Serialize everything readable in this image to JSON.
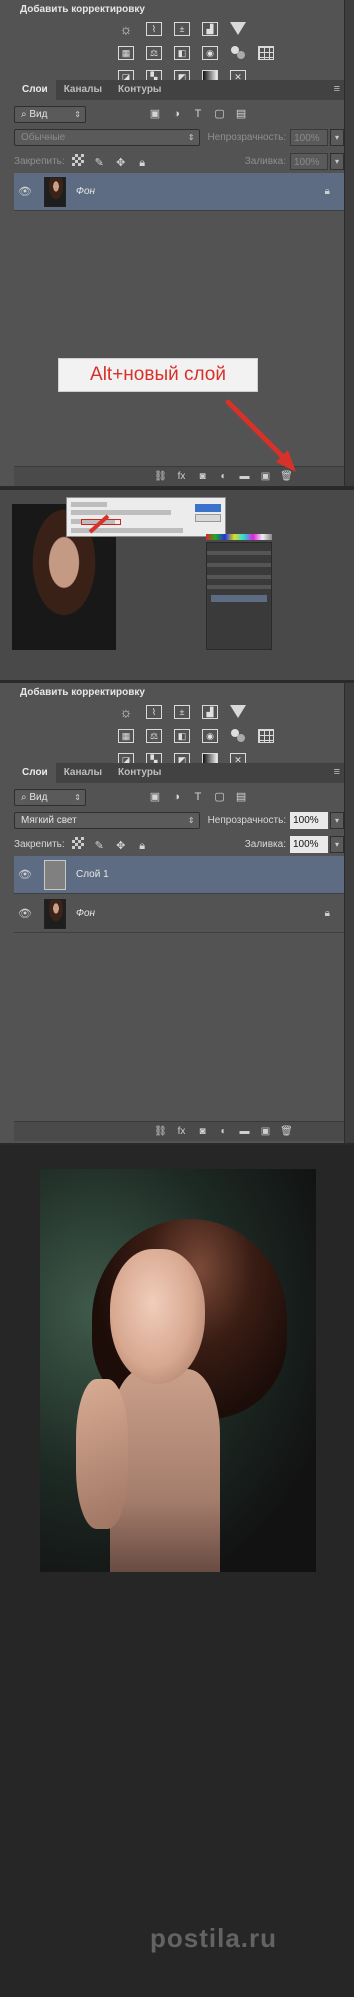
{
  "panel_top": {
    "adjustments_title": "Добавить корректировку",
    "tabs": [
      "Слои",
      "Каналы",
      "Контуры"
    ],
    "filter_label": "Вид",
    "blend_mode": "Обычные",
    "opacity_label": "Непрозрачность:",
    "opacity_value": "100%",
    "lock_label": "Закрепить:",
    "fill_label": "Заливка:",
    "fill_value": "100%",
    "layers": [
      {
        "name": "Фон",
        "locked": true,
        "selected": true
      }
    ]
  },
  "annotation": {
    "tooltip_text": "Alt+новый слой",
    "accent_color": "#d7322a"
  },
  "panel_bottom": {
    "adjustments_title": "Добавить корректировку",
    "tabs": [
      "Слои",
      "Каналы",
      "Контуры"
    ],
    "filter_label": "Вид",
    "blend_mode": "Мягкий свет",
    "opacity_label": "Непрозрачность:",
    "opacity_value": "100%",
    "lock_label": "Закрепить:",
    "fill_label": "Заливка:",
    "fill_value": "100%",
    "layers": [
      {
        "name": "Слой 1",
        "selected": true
      },
      {
        "name": "Фон",
        "locked": true
      }
    ]
  },
  "footer": {
    "watermark": "postila.ru"
  }
}
